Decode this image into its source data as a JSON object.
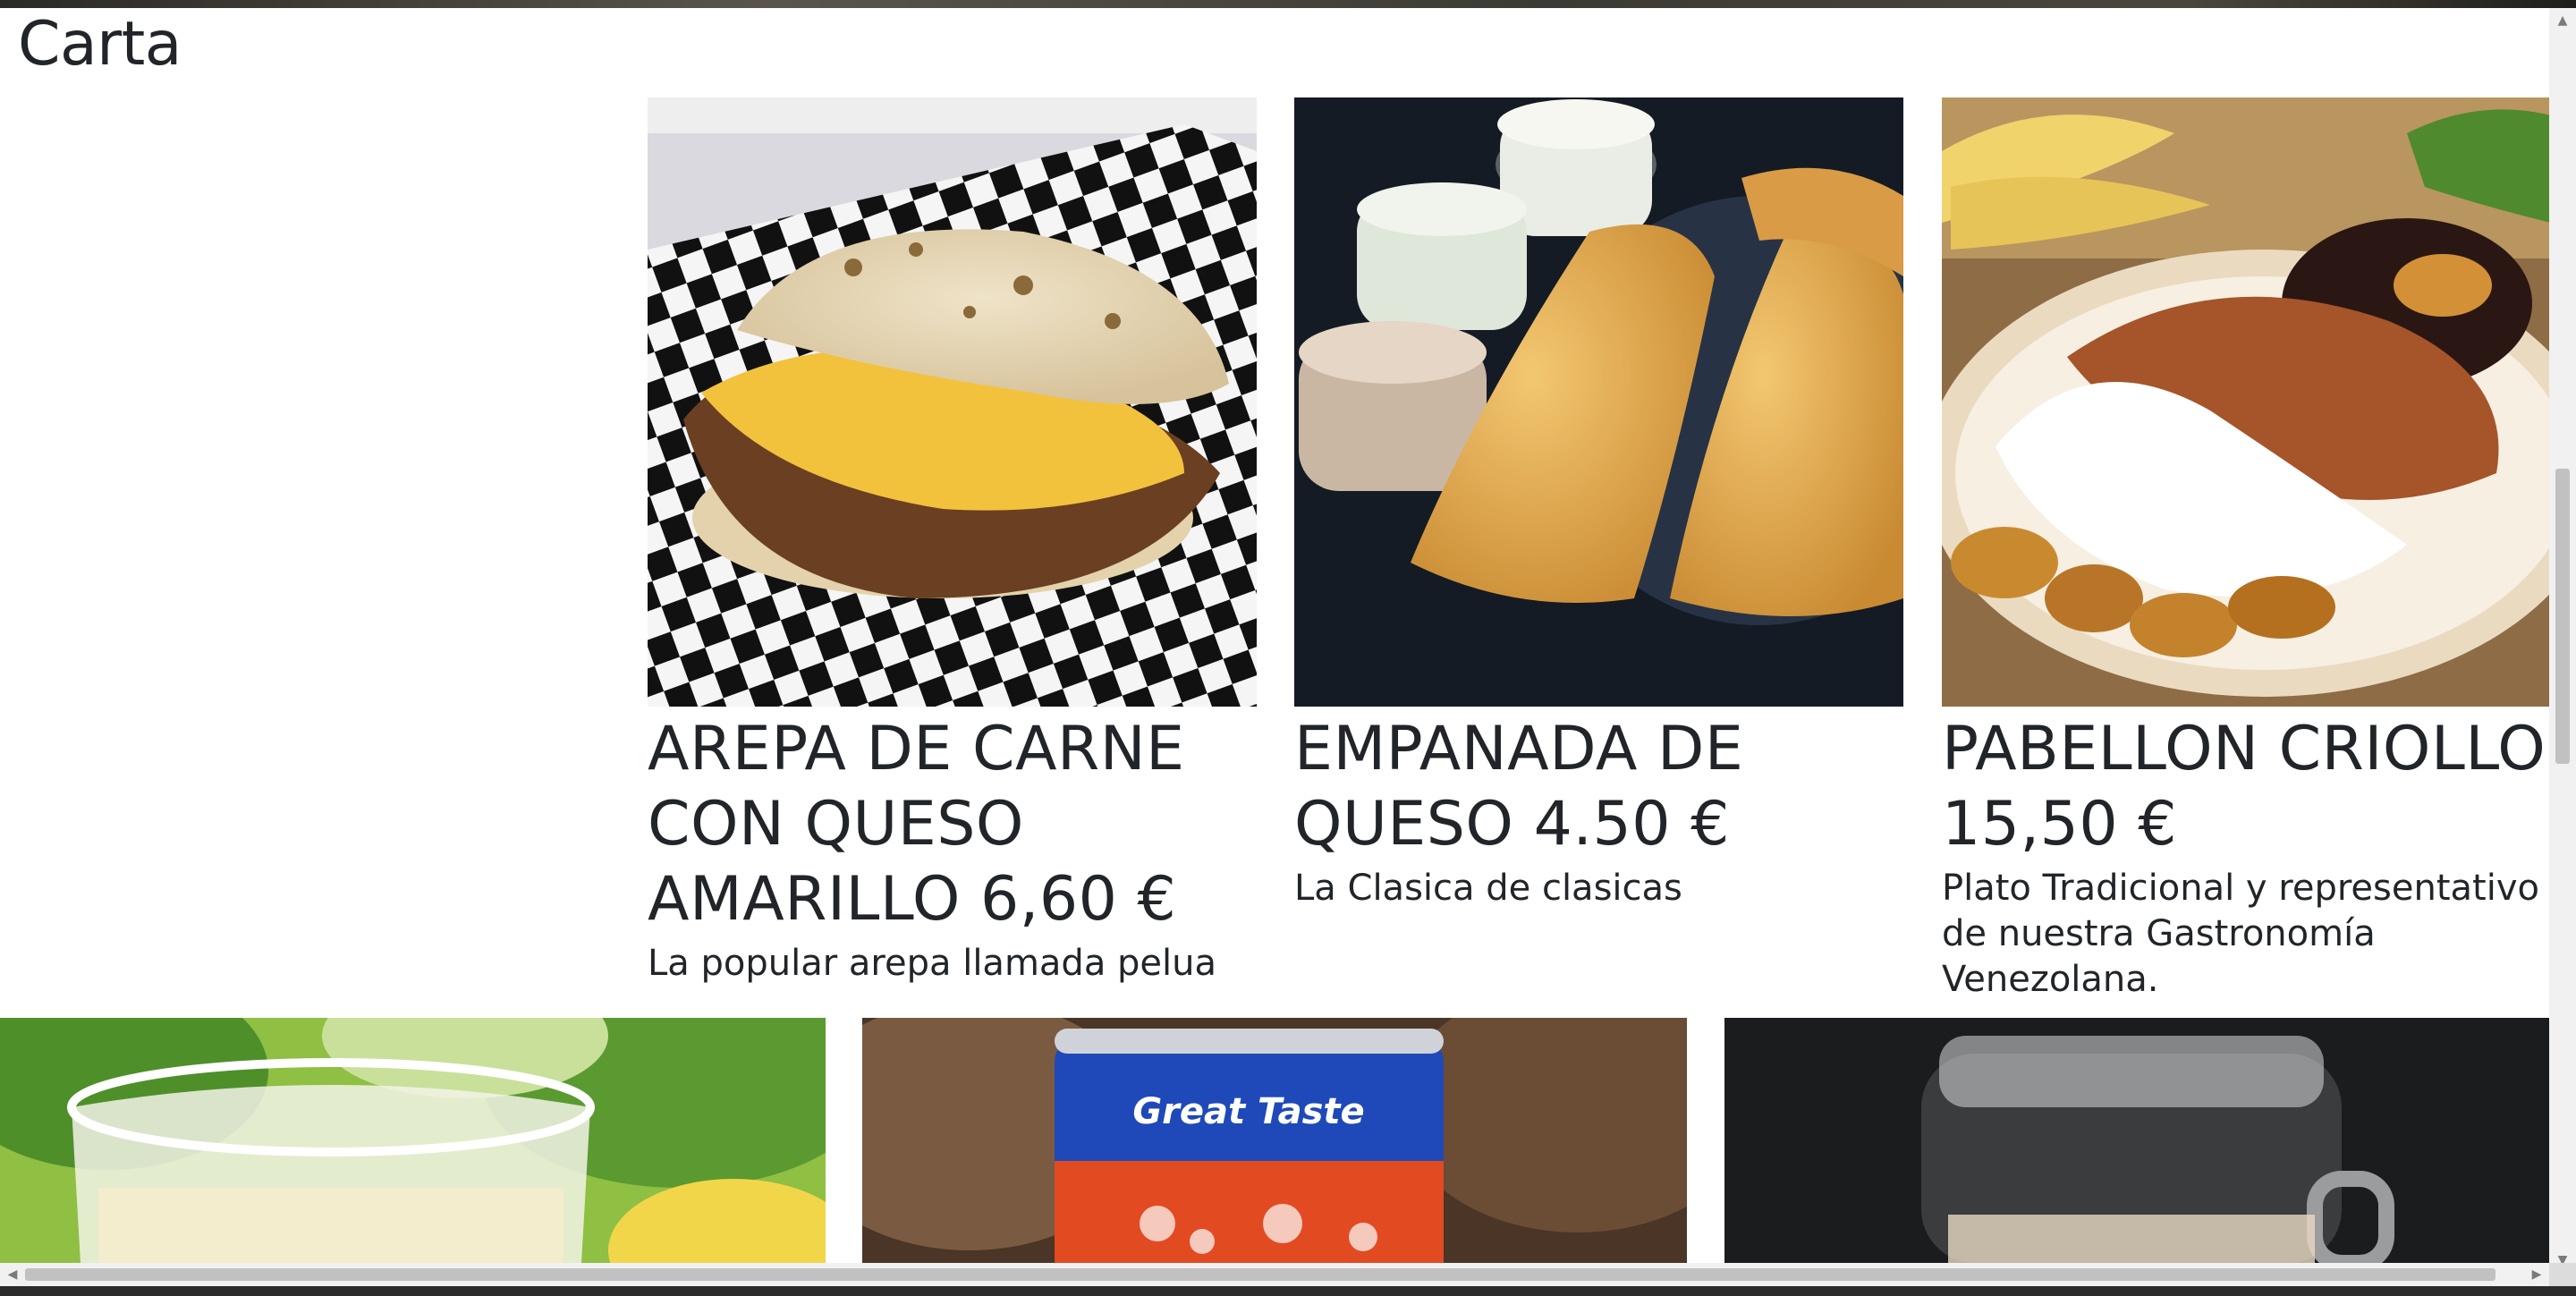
{
  "page": {
    "title": "Carta"
  },
  "menu_items": [
    {
      "name": "AREPA DE CARNE CON QUESO AMARILLO 6,60 €",
      "description": "La popular arepa llamada pelua"
    },
    {
      "name": "EMPANADA DE QUESO 4.50 €",
      "description": "La Clasica de clasicas"
    },
    {
      "name": "PABELLON CRIOLLO 15,50 €",
      "description": "Plato Tradicional y representativo de nuestra Gastronomía Venezolana."
    }
  ],
  "can_label": "Great Taste",
  "scrollbars": {
    "up": "▲",
    "down": "▼",
    "left": "◀",
    "right": "▶"
  }
}
